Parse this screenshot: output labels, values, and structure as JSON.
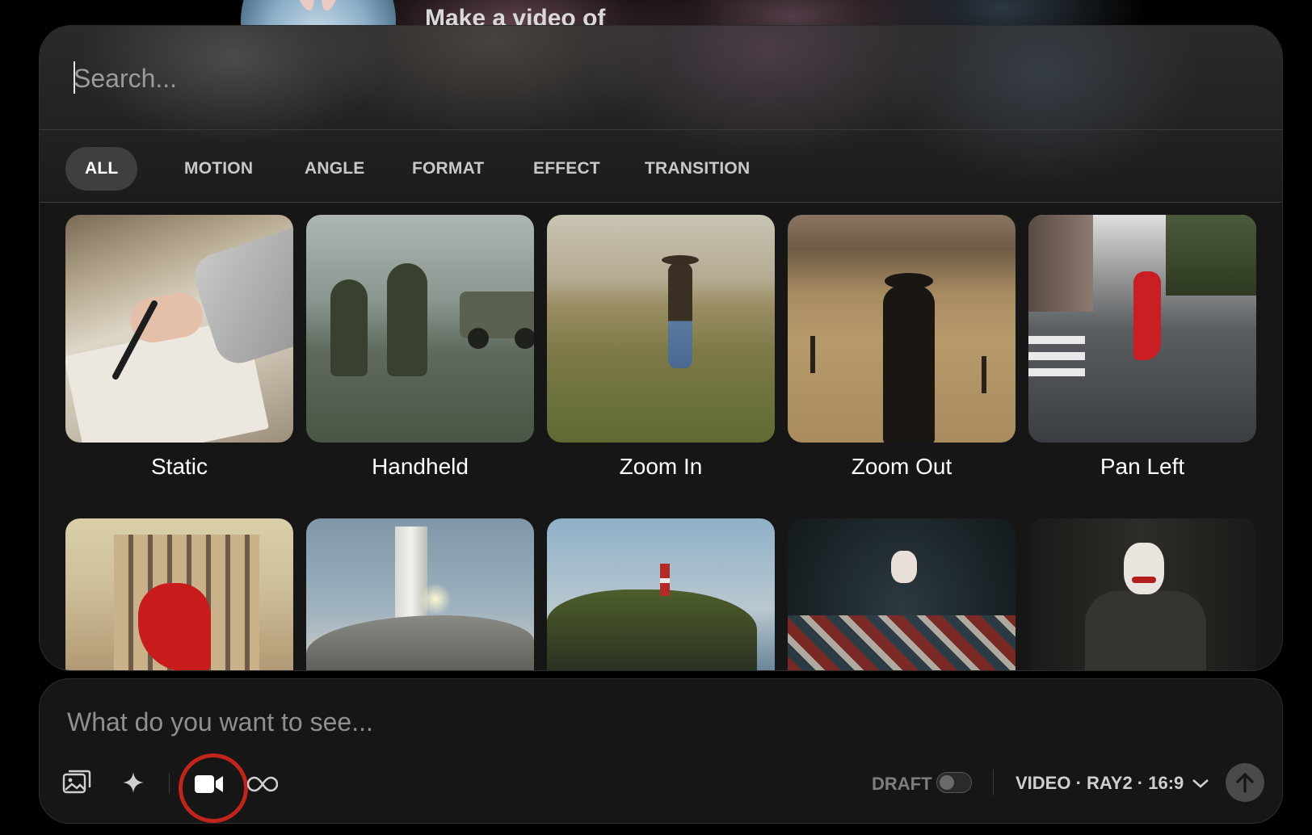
{
  "background": {
    "prompt_text": "Make a video of"
  },
  "search": {
    "placeholder": "Search..."
  },
  "tabs": [
    {
      "label": "ALL",
      "active": true
    },
    {
      "label": "MOTION",
      "active": false
    },
    {
      "label": "ANGLE",
      "active": false
    },
    {
      "label": "FORMAT",
      "active": false
    },
    {
      "label": "EFFECT",
      "active": false
    },
    {
      "label": "TRANSITION",
      "active": false
    }
  ],
  "presets": [
    {
      "label": "Static",
      "thumbnail": "hand-writing-on-paper"
    },
    {
      "label": "Handheld",
      "thumbnail": "soldiers-running-jeep"
    },
    {
      "label": "Zoom In",
      "thumbnail": "cowboy-in-field"
    },
    {
      "label": "Zoom Out",
      "thumbnail": "cowboy-silhouette-field"
    },
    {
      "label": "Pan Left",
      "thumbnail": "woman-red-dress-street"
    },
    {
      "label": "",
      "thumbnail": "woman-red-dress-paris"
    },
    {
      "label": "",
      "thumbnail": "lighthouse-birds-sunburst"
    },
    {
      "label": "",
      "thumbnail": "lighthouse-on-cliff"
    },
    {
      "label": "",
      "thumbnail": "clown-with-toys"
    },
    {
      "label": "",
      "thumbnail": "joker-seated"
    }
  ],
  "prompt": {
    "placeholder": "What do you want to see...",
    "draft_label": "DRAFT",
    "draft_enabled": false,
    "model_label": "VIDEO · RAY2 · 16:9",
    "tools": [
      {
        "icon": "image-gallery-icon"
      },
      {
        "icon": "sparkle-icon"
      },
      {
        "icon": "video-camera-icon",
        "selected": true
      },
      {
        "icon": "infinity-loop-icon"
      }
    ],
    "send_icon": "arrow-up-icon"
  },
  "colors": {
    "highlight_ring": "#c0241a",
    "active_tab_bg": "#3f3f3f",
    "panel_bg": "#161616"
  }
}
